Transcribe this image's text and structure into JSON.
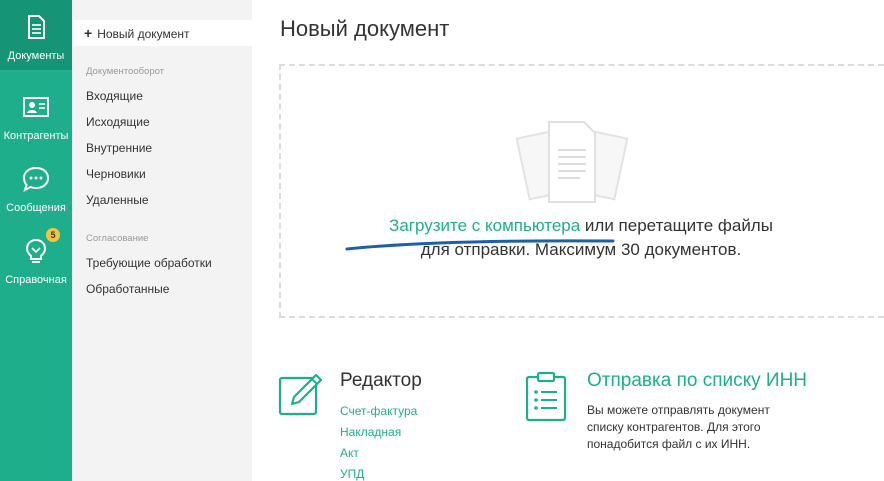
{
  "rail": {
    "items": [
      {
        "label": "Документы",
        "icon": "document-icon",
        "active": true
      },
      {
        "label": "Контрагенты",
        "icon": "contact-card-icon",
        "active": false
      },
      {
        "label": "Сообщения",
        "icon": "chat-bubble-icon",
        "active": false
      },
      {
        "label": "Справочная",
        "icon": "lightbulb-icon",
        "active": false,
        "badge": "5"
      }
    ],
    "colors": {
      "background": "#1fae8c",
      "active": "#159575",
      "badge": "#f4c63d"
    }
  },
  "subnav": {
    "new_document": "Новый документ",
    "sections": [
      {
        "title": "Документооборот",
        "items": [
          "Входящие",
          "Исходящие",
          "Внутренние",
          "Черновики",
          "Удаленные"
        ]
      },
      {
        "title": "Согласование",
        "items": [
          "Требующие обработки",
          "Обработанные"
        ]
      }
    ]
  },
  "main": {
    "title": "Новый документ",
    "dropzone": {
      "upload_link": "Загрузите с компьютера",
      "line1_rest": " или перетащите файлы",
      "line2": "для отправки. Максимум 30 документов."
    },
    "editor": {
      "title": "Редактор",
      "links": [
        "Счет-фактура",
        "Накладная",
        "Акт",
        "УПД"
      ]
    },
    "inn": {
      "title": "Отправка по списку ИНН",
      "description": "Вы можете отправлять документ списку контрагентов. Для этого понадобится файл с их ИНН."
    }
  }
}
